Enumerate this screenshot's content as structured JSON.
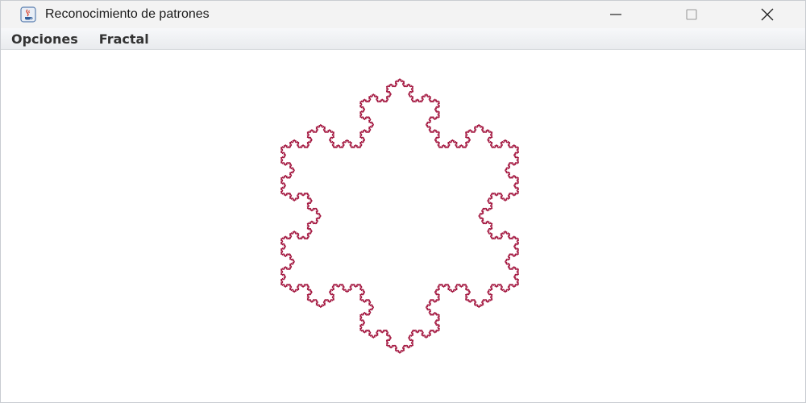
{
  "window": {
    "title": "Reconocimiento de patrones",
    "icon": "java-cup-icon",
    "controls": [
      "minimize-icon",
      "maximize-icon",
      "close-icon"
    ]
  },
  "menubar": {
    "items": [
      {
        "label": "Opciones"
      },
      {
        "label": "Fractal"
      }
    ]
  },
  "canvas": {
    "figure": "koch-snowflake",
    "stroke_color": "#a3163f"
  }
}
